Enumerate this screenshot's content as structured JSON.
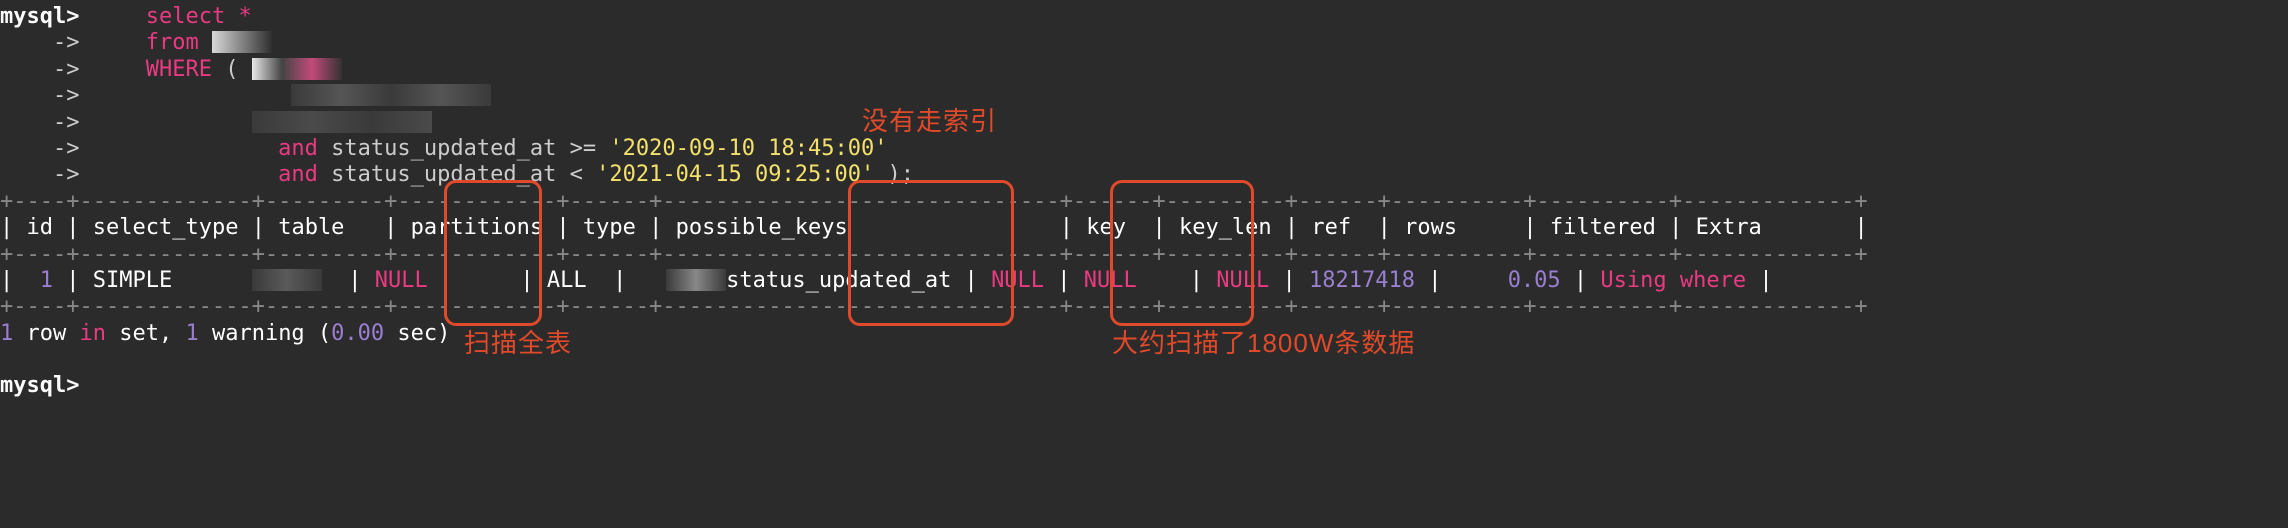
{
  "prompt": "mysql>",
  "cont": "    ->",
  "query": {
    "select": "select",
    "star": "*",
    "from": "from",
    "where": "WHERE",
    "and": "and",
    "col": "status_updated_at",
    "cond1_op": ">=",
    "cond1_val": "'2020-09-10 18:45:00'",
    "cond2_op": "<",
    "cond2_val": "'2021-04-15 09:25:00'",
    "close": ");"
  },
  "table": {
    "rule": "+----+-------------+-------+------------+------+---------------+------+---------+------+----------+----------+-------------+",
    "headers": [
      "id",
      "select_type",
      "table",
      "partitions",
      "type",
      "possible_keys",
      "key",
      "key_len",
      "ref",
      "rows",
      "filtered",
      "Extra"
    ],
    "row": {
      "id": "1",
      "select_type": "SIMPLE",
      "table": "",
      "partitions": "NULL",
      "type": "ALL",
      "possible_keys_suffix": "status_updated_at",
      "key": "NULL",
      "key_len": "NULL",
      "ref": "NULL",
      "rows": "18217418",
      "filtered": "0.05",
      "extra": "Using where"
    }
  },
  "footer": {
    "text1": "1",
    "text2": " row ",
    "text3": "in",
    "text4": " set, ",
    "text5": "1",
    "text6": " warning (",
    "text7": "0.00",
    "text8": " sec)"
  },
  "annotations": {
    "no_index": "没有走索引",
    "full_scan": "扫描全表",
    "rows_scanned": "大约扫描了1800W条数据"
  }
}
